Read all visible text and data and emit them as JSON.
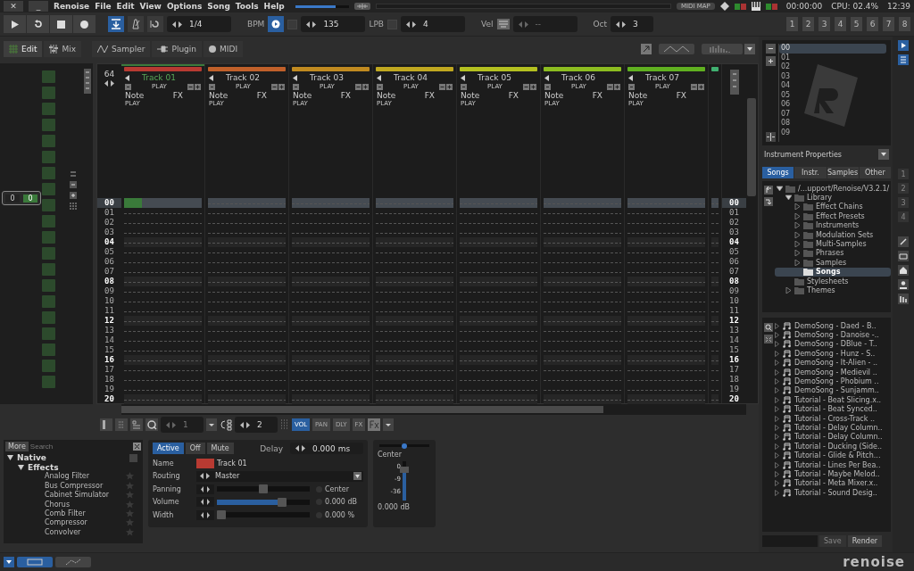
{
  "menubar": {
    "buttons": [
      "✕",
      "_"
    ],
    "menus": [
      "Renoise",
      "File",
      "Edit",
      "View",
      "Options",
      "Song",
      "Tools",
      "Help"
    ],
    "master_volume": {
      "level": 0.75
    },
    "midi_map": "MIDI MAP",
    "time": "00:00:00",
    "cpu": "CPU: 02.4%",
    "clock": "12:39"
  },
  "transport": {
    "follow": true,
    "metronome": false,
    "quantize": "1/4",
    "bpm_label": "BPM",
    "bpm_sync": false,
    "bpm": "135",
    "lpb_label": "LPB",
    "lpb_sync": false,
    "lpb": "4",
    "vel_label": "Vel",
    "vel": "--",
    "oct_label": "Oct",
    "oct": "3",
    "track_buttons": [
      "1",
      "2",
      "3",
      "4",
      "5",
      "6",
      "7",
      "8"
    ]
  },
  "view_tabs": [
    {
      "label": "Edit",
      "selected": true
    },
    {
      "label": "Mix",
      "selected": false
    }
  ],
  "editor_tabs": [
    {
      "label": "Sampler"
    },
    {
      "label": "Plugin"
    },
    {
      "label": "MIDI"
    }
  ],
  "left_panel": {
    "values": [
      "0",
      "0"
    ]
  },
  "pattern": {
    "lines": "64",
    "tracks": [
      {
        "name": "Track 01",
        "color": "#b83a32",
        "selected": true,
        "mute_label": "PLAY",
        "note_label": "Note",
        "fx_label": "FX",
        "column_label": "PLAY"
      },
      {
        "name": "Track 02",
        "color": "#c0602a",
        "selected": false,
        "mute_label": "PLAY",
        "note_label": "Note",
        "fx_label": "FX",
        "column_label": "PLAY"
      },
      {
        "name": "Track 03",
        "color": "#c08a20",
        "selected": false,
        "mute_label": "PLAY",
        "note_label": "Note",
        "fx_label": "FX",
        "column_label": "PLAY"
      },
      {
        "name": "Track 04",
        "color": "#c0a820",
        "selected": false,
        "mute_label": "PLAY",
        "note_label": "Note",
        "fx_label": "FX",
        "column_label": "PLAY"
      },
      {
        "name": "Track 05",
        "color": "#b4c020",
        "selected": false,
        "mute_label": "PLAY",
        "note_label": "Note",
        "fx_label": "FX",
        "column_label": "PLAY"
      },
      {
        "name": "Track 06",
        "color": "#8cbc20",
        "selected": false,
        "mute_label": "PLAY",
        "note_label": "Note",
        "fx_label": "FX",
        "column_label": "PLAY"
      },
      {
        "name": "Track 07",
        "color": "#60b020",
        "selected": false,
        "mute_label": "PLAY",
        "note_label": "Note",
        "fx_label": "FX",
        "column_label": "PLAY"
      },
      {
        "color": "#40b070"
      }
    ],
    "rows_left": [
      {
        "label": "00",
        "beat": true,
        "selected": true
      },
      {
        "label": "01",
        "beat": false,
        "selected": false
      },
      {
        "label": "02",
        "beat": false,
        "selected": false
      },
      {
        "label": "03",
        "beat": false,
        "selected": false
      },
      {
        "label": "04",
        "beat": true,
        "selected": false
      },
      {
        "label": "05",
        "beat": false,
        "selected": false
      },
      {
        "label": "06",
        "beat": false,
        "selected": false
      },
      {
        "label": "07",
        "beat": false,
        "selected": false
      },
      {
        "label": "08",
        "beat": true,
        "selected": false
      },
      {
        "label": "09",
        "beat": false,
        "selected": false
      },
      {
        "label": "10",
        "beat": false,
        "selected": false
      },
      {
        "label": "11",
        "beat": false,
        "selected": false
      },
      {
        "label": "12",
        "beat": true,
        "selected": false
      },
      {
        "label": "13",
        "beat": false,
        "selected": false
      },
      {
        "label": "14",
        "beat": false,
        "selected": false
      },
      {
        "label": "15",
        "beat": false,
        "selected": false
      },
      {
        "label": "16",
        "beat": true,
        "selected": false
      },
      {
        "label": "17",
        "beat": false,
        "selected": false
      },
      {
        "label": "18",
        "beat": false,
        "selected": false
      },
      {
        "label": "19",
        "beat": false,
        "selected": false
      },
      {
        "label": "20",
        "beat": true,
        "selected": false
      }
    ],
    "rows_right": [
      {
        "label": "00",
        "beat": true,
        "selected": true
      },
      {
        "label": "01",
        "beat": false,
        "selected": false
      },
      {
        "label": "02",
        "beat": false,
        "selected": false
      },
      {
        "label": "03",
        "beat": false,
        "selected": false
      },
      {
        "label": "04",
        "beat": true,
        "selected": false
      },
      {
        "label": "05",
        "beat": false,
        "selected": false
      },
      {
        "label": "06",
        "beat": false,
        "selected": false
      },
      {
        "label": "07",
        "beat": false,
        "selected": false
      },
      {
        "label": "08",
        "beat": true,
        "selected": false
      },
      {
        "label": "09",
        "beat": false,
        "selected": false
      },
      {
        "label": "10",
        "beat": false,
        "selected": false
      },
      {
        "label": "11",
        "beat": false,
        "selected": false
      },
      {
        "label": "12",
        "beat": true,
        "selected": false
      },
      {
        "label": "13",
        "beat": false,
        "selected": false
      },
      {
        "label": "14",
        "beat": false,
        "selected": false
      },
      {
        "label": "15",
        "beat": false,
        "selected": false
      },
      {
        "label": "16",
        "beat": true,
        "selected": false
      },
      {
        "label": "17",
        "beat": false,
        "selected": false
      },
      {
        "label": "18",
        "beat": false,
        "selected": false
      },
      {
        "label": "19",
        "beat": false,
        "selected": false
      },
      {
        "label": "20",
        "beat": true,
        "selected": false
      }
    ]
  },
  "pattern_toolbar": {
    "quantize": "1",
    "edit_step": "2",
    "columns": [
      {
        "label": "VOL",
        "on": true
      },
      {
        "label": "PAN",
        "on": false
      },
      {
        "label": "DLY",
        "on": false
      },
      {
        "label": "FX",
        "on": false
      }
    ]
  },
  "effects_browser": {
    "more": "More",
    "search_placeholder": "Search",
    "favorites_only": false,
    "tree": [
      {
        "label": "Native",
        "expanded": true,
        "children": [
          {
            "label": "Effects",
            "expanded": true,
            "children": [
              {
                "label": "Analog Filter"
              },
              {
                "label": "Bus Compressor"
              },
              {
                "label": "Cabinet Simulator"
              },
              {
                "label": "Chorus"
              },
              {
                "label": "Comb Filter"
              },
              {
                "label": "Compressor"
              },
              {
                "label": "Convolver"
              }
            ]
          }
        ]
      }
    ]
  },
  "track_dsp": {
    "states": [
      {
        "label": "Active",
        "selected": true
      },
      {
        "label": "Off",
        "selected": false
      },
      {
        "label": "Mute",
        "selected": false
      }
    ],
    "delay_label": "Delay",
    "delay": "0.000 ms",
    "name_label": "Name",
    "name": "Track 01",
    "routing_label": "Routing",
    "routing": "Master",
    "params": [
      {
        "label": "Panning",
        "level": 0.5,
        "checked": false,
        "reading": "Center"
      },
      {
        "label": "Volume",
        "level": 0.72,
        "checked": false,
        "reading": "0.000 dB"
      },
      {
        "label": "Width",
        "level": 0,
        "checked": false,
        "reading": "0.000 %"
      }
    ]
  },
  "meter": {
    "pan": {
      "level": 0.5
    },
    "pan_reading": "Center",
    "scale": [
      "0",
      "-9",
      "-36"
    ],
    "fader": {
      "level": 0.8
    },
    "reading": "0.000 dB"
  },
  "sequence": [
    {
      "label": "00",
      "selected": true
    },
    {
      "label": "01",
      "selected": false
    },
    {
      "label": "02",
      "selected": false
    },
    {
      "label": "03",
      "selected": false
    },
    {
      "label": "04",
      "selected": false
    },
    {
      "label": "05",
      "selected": false
    },
    {
      "label": "06",
      "selected": false
    },
    {
      "label": "07",
      "selected": false
    },
    {
      "label": "08",
      "selected": false
    },
    {
      "label": "09",
      "selected": false
    }
  ],
  "instrument_properties": "Instrument Properties",
  "disk_tabs": [
    {
      "label": "Songs",
      "selected": true
    },
    {
      "label": "Instr.",
      "selected": false
    },
    {
      "label": "Samples",
      "selected": false
    },
    {
      "label": "Other",
      "selected": false
    }
  ],
  "disk_tree": [
    {
      "label": "/...upport/Renoise/V3.2.1/",
      "expanded": true,
      "selected": false,
      "children": [
        {
          "label": "Library",
          "expanded": true,
          "selected": false,
          "children": [
            {
              "label": "Effect Chains",
              "expanded": false,
              "selected": false
            },
            {
              "label": "Effect Presets",
              "expanded": false,
              "selected": false
            },
            {
              "label": "Instruments",
              "expanded": false,
              "selected": false
            },
            {
              "label": "Modulation Sets",
              "expanded": false,
              "selected": false
            },
            {
              "label": "Multi-Samples",
              "expanded": false,
              "selected": false
            },
            {
              "label": "Phrases",
              "expanded": false,
              "selected": false
            },
            {
              "label": "Samples",
              "expanded": false,
              "selected": false
            },
            {
              "label": "Songs",
              "selected": true
            }
          ]
        },
        {
          "label": "Stylesheets",
          "selected": false
        },
        {
          "label": "Themes",
          "expanded": false,
          "selected": false
        }
      ]
    }
  ],
  "files": [
    "DemoSong - Daed - B..",
    "DemoSong - Danoise -..",
    "DemoSong - DBlue - T..",
    "DemoSong - Hunz - S..",
    "DemoSong - It-Alien - ..",
    "DemoSong - Medievil ..",
    "DemoSong - Phobium ..",
    "DemoSong - Sunjamm..",
    "Tutorial - Beat Slicing.x..",
    "Tutorial - Beat Synced..",
    "Tutorial - Cross-Track ..",
    "Tutorial - Delay Column..",
    "Tutorial - Delay Column..",
    "Tutorial - Ducking (Side..",
    "Tutorial - Glide & Pitch...",
    "Tutorial - Lines Per Bea..",
    "Tutorial - Maybe Melod..",
    "Tutorial - Meta Mixer.x..",
    "Tutorial - Sound Desig.."
  ],
  "file_buttons": [
    {
      "label": "Save",
      "disabled": true
    },
    {
      "label": "Render",
      "disabled": false
    }
  ],
  "side_strip": [
    {
      "label": "1",
      "disabled": true
    },
    {
      "label": "2",
      "disabled": true
    },
    {
      "label": "3",
      "disabled": true
    },
    {
      "label": "4",
      "disabled": true
    }
  ],
  "status_bar": {
    "logo": "renoise"
  }
}
